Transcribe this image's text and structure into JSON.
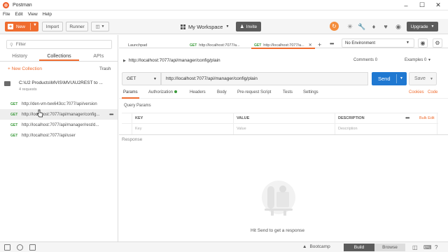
{
  "window": {
    "title": "Postman"
  },
  "menu": [
    "File",
    "Edit",
    "View",
    "Help"
  ],
  "toolbar": {
    "new_label": "New",
    "import_label": "Import",
    "runner_label": "Runner",
    "workspace_label": "My Workspace",
    "invite_label": "Invite",
    "upgrade_label": "Upgrade"
  },
  "sidebar": {
    "filter_placeholder": "Filter",
    "tabs": [
      "History",
      "Collections",
      "APIs"
    ],
    "active_tab": "Collections",
    "new_collection_label": "+ New Collection",
    "trash_label": "Trash",
    "collection": {
      "name": "C:\\U2 Products\\MVIS\\MVU\\U2REST to ...",
      "count": "4 requests"
    },
    "requests": [
      {
        "method": "GET",
        "url": "http://den-vm-twx643cc:7077/api/version"
      },
      {
        "method": "GET",
        "url": "http://localhost:7077/api/manager/config..."
      },
      {
        "method": "GET",
        "url": "http://localhost:7077/api/manager/rest/d..."
      },
      {
        "method": "GET",
        "url": "http://localhost:7077/api/user"
      }
    ]
  },
  "tabs": {
    "launchpad": "Launchpad",
    "tab1": {
      "method": "GET",
      "url": "http://localhost:7077/a..."
    },
    "tab2": {
      "method": "GET",
      "url": "http://localhost:7077/a..."
    },
    "environment": "No Environment"
  },
  "request": {
    "name": "http://localhost:7077/api/manager/config/plain",
    "comments_label": "Comments",
    "comments_count": "0",
    "examples_label": "Examples",
    "examples_count": "0",
    "method": "GET",
    "url": "http://localhost:7077/api/manager/config/plain",
    "send_label": "Send",
    "save_label": "Save",
    "subtabs": [
      "Params",
      "Authorization",
      "Headers",
      "Body",
      "Pre-request Script",
      "Tests",
      "Settings"
    ],
    "cookies_label": "Cookies",
    "code_label": "Code",
    "query_params_label": "Query Params",
    "table": {
      "headers": [
        "KEY",
        "VALUE",
        "DESCRIPTION"
      ],
      "placeholders": [
        "Key",
        "Value",
        "Description"
      ],
      "bulk_edit_label": "Bulk Edit"
    }
  },
  "response": {
    "label": "Response",
    "hint": "Hit Send to get a response"
  },
  "statusbar": {
    "bootcamp_label": "Bootcamp",
    "build_label": "Build",
    "browse_label": "Browse"
  },
  "colors": {
    "accent": "#ef6c2f",
    "send": "#1f78d1",
    "get": "#3a9a3a"
  }
}
